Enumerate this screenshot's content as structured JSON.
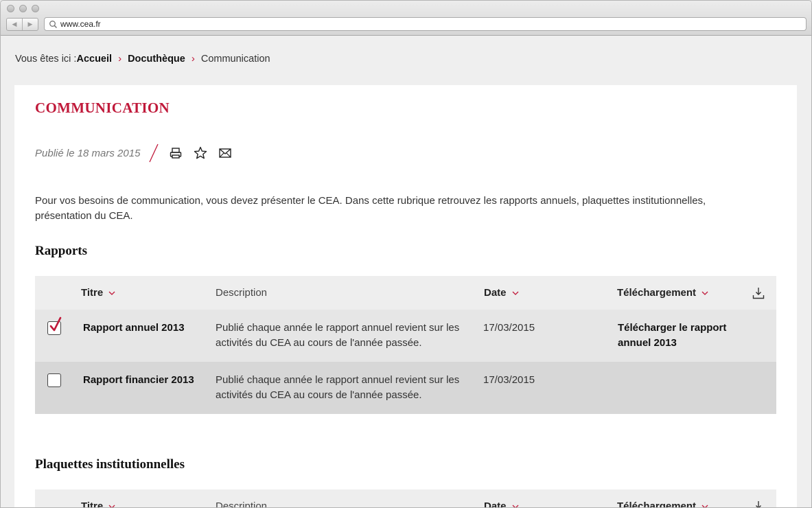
{
  "browser": {
    "url": "www.cea.fr",
    "back_glyph": "◀",
    "forward_glyph": "▶"
  },
  "breadcrumb": {
    "prefix": "Vous êtes ici :",
    "items": [
      "Accueil",
      "Docuthèque"
    ],
    "current": "Communication",
    "separator": "›"
  },
  "page": {
    "title": "COMMUNICATION",
    "published": "Publié le 18 mars 2015",
    "actions": [
      "print-icon",
      "star-icon",
      "mail-icon"
    ],
    "intro": "Pour vos besoins de communication, vous devez présenter le CEA. Dans cette rubrique retrouvez les rapports annuels, plaquettes institutionnelles, présentation du CEA."
  },
  "columns": {
    "title": "Titre",
    "description": "Description",
    "date": "Date",
    "download": "Téléchargement"
  },
  "sections": [
    {
      "title": "Rapports",
      "rows": [
        {
          "checked": true,
          "title": "Rapport annuel 2013",
          "description": "Publié chaque année le rapport annuel revient sur les activités du CEA au cours de l'année passée.",
          "date": "17/03/2015",
          "download": "Télécharger le rapport annuel 2013"
        },
        {
          "checked": false,
          "title": "Rapport financier 2013",
          "description": "Publié chaque année le rapport annuel revient sur les activités du CEA au cours de l'année passée.",
          "date": "17/03/2015",
          "download": ""
        }
      ]
    },
    {
      "title": "Plaquettes institutionnelles",
      "rows": []
    }
  ],
  "colors": {
    "accent": "#c0193a",
    "header_bg": "#eeeeee",
    "row_bg_1": "#e6e6e6",
    "row_bg_2": "#d7d7d7"
  }
}
